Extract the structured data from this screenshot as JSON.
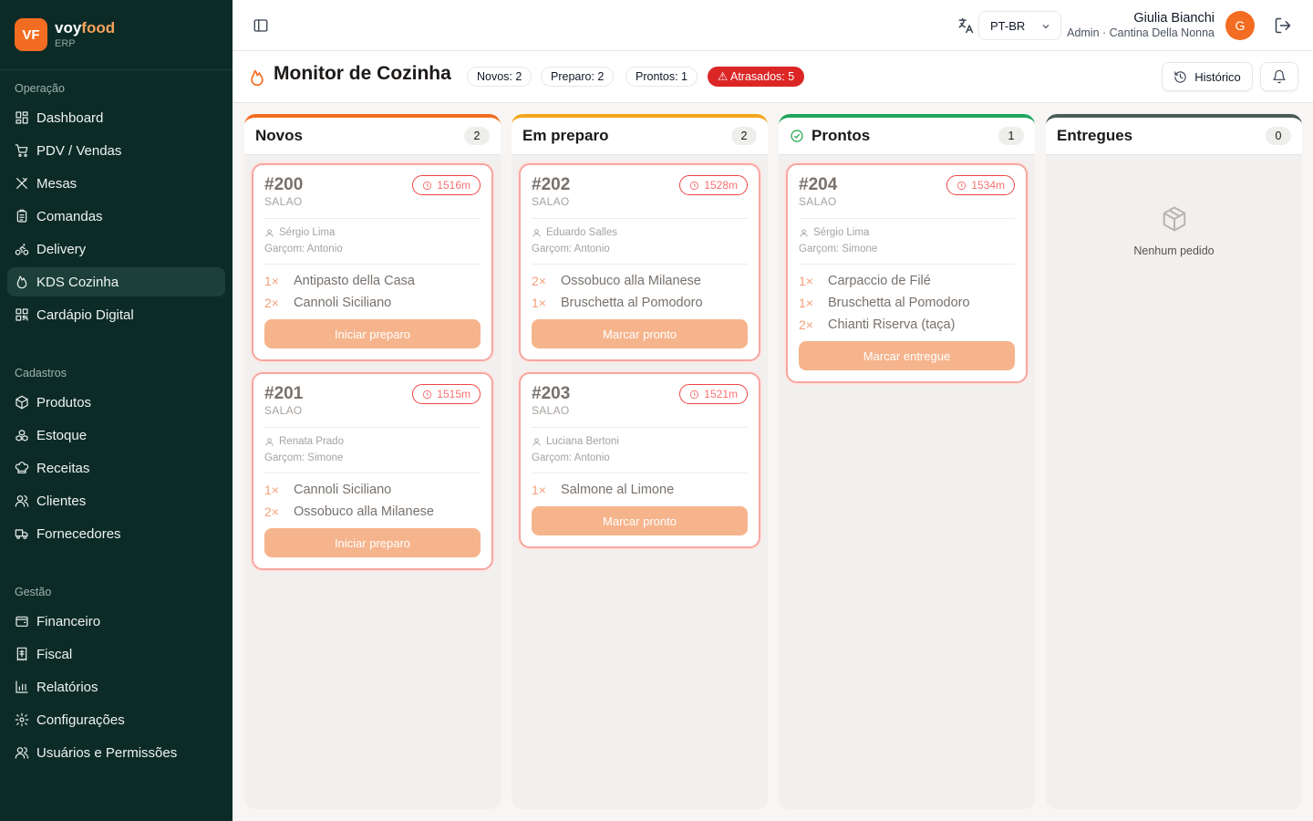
{
  "brand": {
    "logo": "VF",
    "name_part1": "voy",
    "name_part2": "food",
    "sub": "ERP"
  },
  "nav": [
    {
      "title": "Operação",
      "items": [
        {
          "label": "Dashboard",
          "icon": "dashboard-icon"
        },
        {
          "label": "PDV / Vendas",
          "icon": "cart-icon"
        },
        {
          "label": "Mesas",
          "icon": "utensils-icon"
        },
        {
          "label": "Comandas",
          "icon": "clipboard-icon"
        },
        {
          "label": "Delivery",
          "icon": "bike-icon"
        },
        {
          "label": "KDS Cozinha",
          "icon": "flame-icon",
          "active": true
        },
        {
          "label": "Cardápio Digital",
          "icon": "qrcode-icon"
        }
      ]
    },
    {
      "title": "Cadastros",
      "items": [
        {
          "label": "Produtos",
          "icon": "package-icon"
        },
        {
          "label": "Estoque",
          "icon": "boxes-icon"
        },
        {
          "label": "Receitas",
          "icon": "chef-hat-icon"
        },
        {
          "label": "Clientes",
          "icon": "users-icon"
        },
        {
          "label": "Fornecedores",
          "icon": "truck-icon"
        }
      ]
    },
    {
      "title": "Gestão",
      "items": [
        {
          "label": "Financeiro",
          "icon": "wallet-icon"
        },
        {
          "label": "Fiscal",
          "icon": "receipt-icon"
        },
        {
          "label": "Relatórios",
          "icon": "bar-chart-icon"
        },
        {
          "label": "Configurações",
          "icon": "gear-icon"
        },
        {
          "label": "Usuários e Permissões",
          "icon": "users-icon"
        }
      ]
    }
  ],
  "topbar": {
    "language": "PT-BR",
    "user_name": "Giulia Bianchi",
    "user_role": "Admin · Cantina Della Nonna",
    "avatar_initial": "G"
  },
  "header": {
    "title": "Monitor de Cozinha",
    "badges": {
      "novos": "Novos: 2",
      "preparo": "Preparo: 2",
      "prontos": "Prontos: 1",
      "atrasados": "⚠ Atrasados: 5"
    },
    "history_label": "Histórico"
  },
  "colors": {
    "novos": "#f26d21",
    "preparo": "#f5a51c",
    "prontos": "#22a45d",
    "entregues": "#4b5b5a"
  },
  "columns": {
    "novos": {
      "title": "Novos",
      "count": "2",
      "cards": [
        {
          "number": "#200",
          "type": "SALAO",
          "timer": "1516m",
          "customer": "Sérgio Lima",
          "waiter": "Garçom: Antonio",
          "items": [
            {
              "qty": "1×",
              "name": "Antipasto della Casa"
            },
            {
              "qty": "2×",
              "name": "Cannoli Siciliano"
            }
          ],
          "action": "Iniciar preparo"
        },
        {
          "number": "#201",
          "type": "SALAO",
          "timer": "1515m",
          "customer": "Renata Prado",
          "waiter": "Garçom: Simone",
          "items": [
            {
              "qty": "1×",
              "name": "Cannoli Siciliano"
            },
            {
              "qty": "2×",
              "name": "Ossobuco alla Milanese"
            }
          ],
          "action": "Iniciar preparo"
        }
      ]
    },
    "preparo": {
      "title": "Em preparo",
      "count": "2",
      "cards": [
        {
          "number": "#202",
          "type": "SALAO",
          "timer": "1528m",
          "customer": "Eduardo Salles",
          "waiter": "Garçom: Antonio",
          "items": [
            {
              "qty": "2×",
              "name": "Ossobuco alla Milanese"
            },
            {
              "qty": "1×",
              "name": "Bruschetta al Pomodoro"
            }
          ],
          "action": "Marcar pronto"
        },
        {
          "number": "#203",
          "type": "SALAO",
          "timer": "1521m",
          "customer": "Luciana Bertoni",
          "waiter": "Garçom: Antonio",
          "items": [
            {
              "qty": "1×",
              "name": "Salmone al Limone"
            }
          ],
          "action": "Marcar pronto"
        }
      ]
    },
    "prontos": {
      "title": "Prontos",
      "count": "1",
      "cards": [
        {
          "number": "#204",
          "type": "SALAO",
          "timer": "1534m",
          "customer": "Sérgio Lima",
          "waiter": "Garçom: Simone",
          "items": [
            {
              "qty": "1×",
              "name": "Carpaccio de Filé"
            },
            {
              "qty": "1×",
              "name": "Bruschetta al Pomodoro"
            },
            {
              "qty": "2×",
              "name": "Chianti Riserva (taça)"
            }
          ],
          "action": "Marcar entregue"
        }
      ]
    },
    "entregues": {
      "title": "Entregues",
      "count": "0",
      "cards": [],
      "empty_text": "Nenhum pedido"
    }
  }
}
